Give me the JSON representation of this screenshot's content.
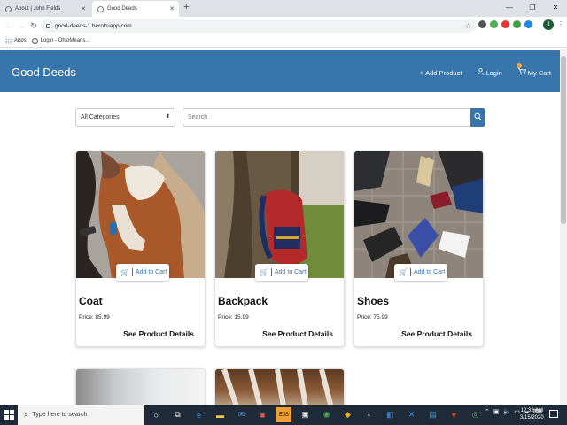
{
  "browser": {
    "tabs": [
      {
        "title": "About | John Fields",
        "active": false
      },
      {
        "title": "Good Deeds",
        "active": true
      }
    ],
    "url": "good-deeds-1.herokuapp.com",
    "profile_initial": "J",
    "bookmarks": [
      {
        "label": "Apps",
        "icon": "apps-grid-icon"
      },
      {
        "label": "Login - OhioMeans...",
        "icon": "globe-icon"
      }
    ]
  },
  "site": {
    "brand": "Good Deeds",
    "nav": {
      "add_product": "Add Product",
      "login": "Login",
      "cart": "My Cart"
    },
    "colors": {
      "primary": "#3775ab"
    }
  },
  "filters": {
    "category_selected": "All Categories",
    "search_placeholder": "Search"
  },
  "products": [
    {
      "name": "Coat",
      "price": "Price: 85.99",
      "add_label": "Add to Cart",
      "details_label": "See Product Details"
    },
    {
      "name": "Backpack",
      "price": "Price: 15.99",
      "add_label": "Add to Cart",
      "details_label": "See Product Details"
    },
    {
      "name": "Shoes",
      "price": "Price: 75.99",
      "add_label": "Add to Cart",
      "details_label": "See Product Details"
    }
  ],
  "taskbar": {
    "search_placeholder": "Type here to search",
    "time": "12:32 AM",
    "date": "3/15/2020"
  }
}
